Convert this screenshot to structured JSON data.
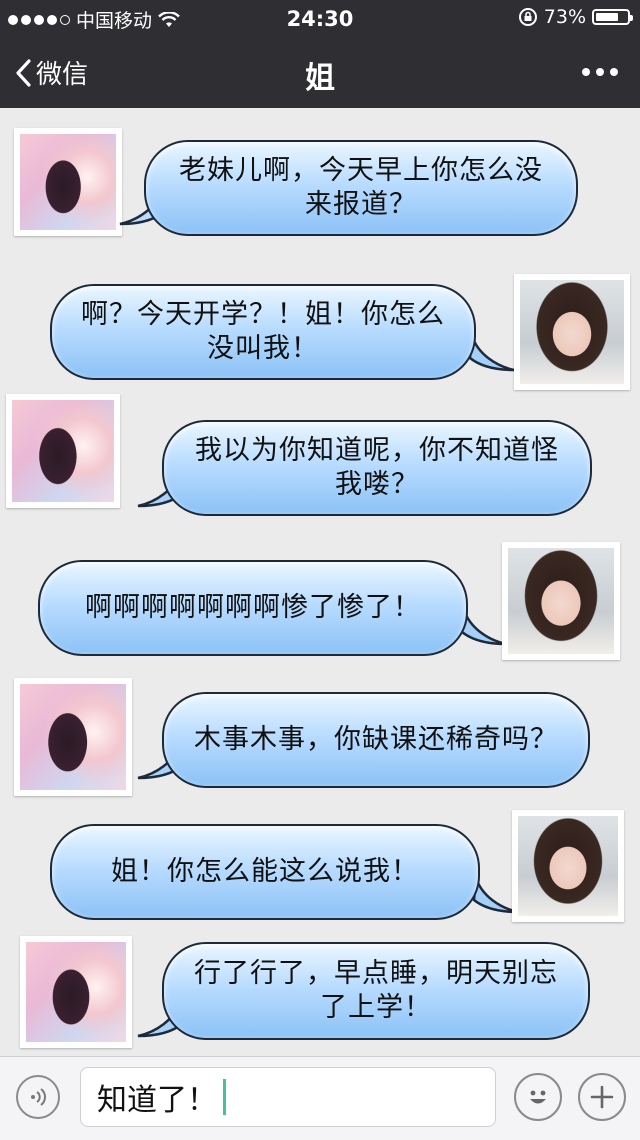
{
  "status_bar": {
    "carrier": "中国移动",
    "time": "24:30",
    "battery": "73%",
    "battery_level": 0.73
  },
  "nav": {
    "back_label": "微信",
    "title": "姐"
  },
  "messages": [
    {
      "sender": "sister",
      "text": "老妹儿啊，今天早上你怎么没来报道？"
    },
    {
      "sender": "me",
      "text": "啊？今天开学？！姐！你怎么没叫我！"
    },
    {
      "sender": "sister",
      "text": "我以为你知道呢，你不知道怪我喽？"
    },
    {
      "sender": "me",
      "text": "啊啊啊啊啊啊啊惨了惨了！"
    },
    {
      "sender": "sister",
      "text": "木事木事，你缺课还稀奇吗？"
    },
    {
      "sender": "me",
      "text": "姐！你怎么能这么说我！"
    },
    {
      "sender": "sister",
      "text": "行了行了，早点睡，明天别忘了上学！"
    }
  ],
  "input": {
    "value": "知道了！"
  },
  "icons": {
    "signal": "signal-dots-icon",
    "wifi": "wifi-icon",
    "lock": "rotation-lock-icon",
    "battery": "battery-icon",
    "back": "chevron-left-icon",
    "more": "more-dots-icon",
    "voice": "voice-icon",
    "emoji": "emoji-icon",
    "plus": "plus-icon"
  },
  "colors": {
    "bar_bg": "#2e2e33",
    "bubble_top": "#eaf6ff",
    "bubble_bottom": "#8cc2f6",
    "caret": "#43c1a1"
  }
}
